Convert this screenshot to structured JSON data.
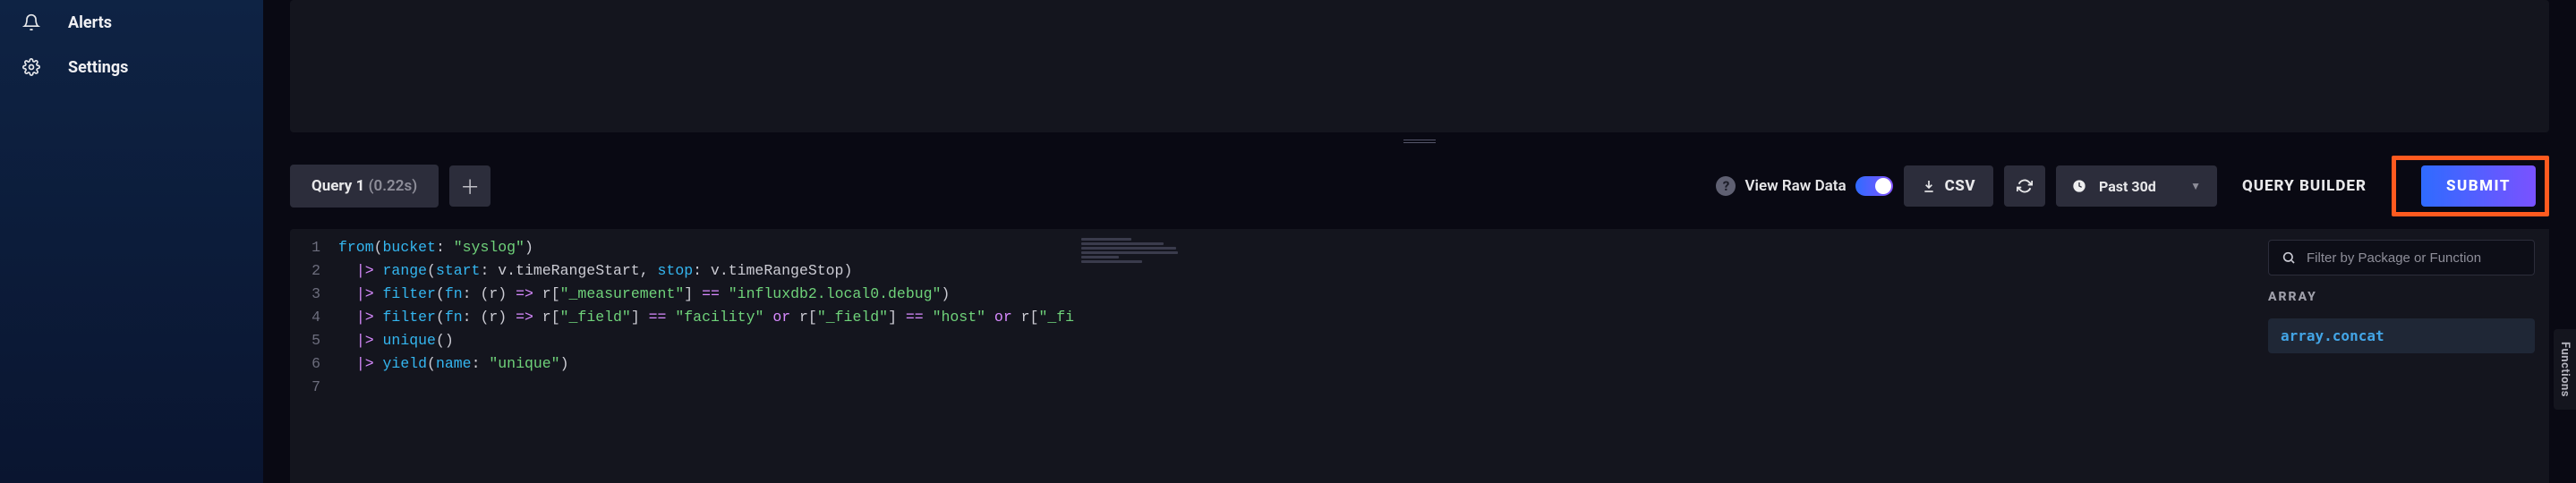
{
  "sidebar": {
    "items": [
      {
        "label": "Alerts",
        "icon": "bell-icon"
      },
      {
        "label": "Settings",
        "icon": "gear-icon"
      }
    ]
  },
  "toolbar": {
    "query_tab_label": "Query 1",
    "query_tab_duration": "(0.22s)",
    "view_raw_data_label": "View Raw Data",
    "raw_data_on": true,
    "csv_label": "CSV",
    "time_range_label": "Past 30d",
    "query_builder_label": "QUERY BUILDER",
    "submit_label": "SUBMIT"
  },
  "editor": {
    "flux_source": "from(bucket: \"syslog\")\n  |> range(start: v.timeRangeStart, stop: v.timeRangeStop)\n  |> filter(fn: (r) => r[\"_measurement\"] == \"influxdb2.local0.debug\")\n  |> filter(fn: (r) => r[\"_field\"] == \"facility\" or r[\"_field\"] == \"host\" or r[\"_fi\n  |> unique()\n  |> yield(name: \"unique\")\n",
    "lines": [
      {
        "n": 1,
        "tokens": [
          {
            "t": "from",
            "c": "tok-fn"
          },
          {
            "t": "(",
            "c": "tok-id"
          },
          {
            "t": "bucket",
            "c": "tok-key"
          },
          {
            "t": ": ",
            "c": "tok-colon"
          },
          {
            "t": "\"syslog\"",
            "c": "tok-str"
          },
          {
            "t": ")",
            "c": "tok-id"
          }
        ]
      },
      {
        "n": 2,
        "tokens": [
          {
            "t": "  ",
            "c": "tok-id"
          },
          {
            "t": "|>",
            "c": "tok-op"
          },
          {
            "t": " ",
            "c": "tok-id"
          },
          {
            "t": "range",
            "c": "tok-fn"
          },
          {
            "t": "(",
            "c": "tok-id"
          },
          {
            "t": "start",
            "c": "tok-key"
          },
          {
            "t": ": v.timeRangeStart, ",
            "c": "tok-var"
          },
          {
            "t": "stop",
            "c": "tok-key"
          },
          {
            "t": ": v.timeRangeStop)",
            "c": "tok-var"
          }
        ]
      },
      {
        "n": 3,
        "tokens": [
          {
            "t": "  ",
            "c": "tok-id"
          },
          {
            "t": "|>",
            "c": "tok-op"
          },
          {
            "t": " ",
            "c": "tok-id"
          },
          {
            "t": "filter",
            "c": "tok-fn"
          },
          {
            "t": "(",
            "c": "tok-id"
          },
          {
            "t": "fn",
            "c": "tok-key"
          },
          {
            "t": ": (r) ",
            "c": "tok-var"
          },
          {
            "t": "=>",
            "c": "tok-op"
          },
          {
            "t": " r[",
            "c": "tok-var"
          },
          {
            "t": "\"_measurement\"",
            "c": "tok-str"
          },
          {
            "t": "] ",
            "c": "tok-var"
          },
          {
            "t": "==",
            "c": "tok-op"
          },
          {
            "t": " ",
            "c": "tok-var"
          },
          {
            "t": "\"influxdb2.local0.debug\"",
            "c": "tok-str"
          },
          {
            "t": ")",
            "c": "tok-var"
          }
        ]
      },
      {
        "n": 4,
        "tokens": [
          {
            "t": "  ",
            "c": "tok-id"
          },
          {
            "t": "|>",
            "c": "tok-op"
          },
          {
            "t": " ",
            "c": "tok-id"
          },
          {
            "t": "filter",
            "c": "tok-fn"
          },
          {
            "t": "(",
            "c": "tok-id"
          },
          {
            "t": "fn",
            "c": "tok-key"
          },
          {
            "t": ": (r) ",
            "c": "tok-var"
          },
          {
            "t": "=>",
            "c": "tok-op"
          },
          {
            "t": " r[",
            "c": "tok-var"
          },
          {
            "t": "\"_field\"",
            "c": "tok-str"
          },
          {
            "t": "] ",
            "c": "tok-var"
          },
          {
            "t": "==",
            "c": "tok-op"
          },
          {
            "t": " ",
            "c": "tok-var"
          },
          {
            "t": "\"facility\"",
            "c": "tok-str"
          },
          {
            "t": " ",
            "c": "tok-var"
          },
          {
            "t": "or",
            "c": "tok-op"
          },
          {
            "t": " r[",
            "c": "tok-var"
          },
          {
            "t": "\"_field\"",
            "c": "tok-str"
          },
          {
            "t": "] ",
            "c": "tok-var"
          },
          {
            "t": "==",
            "c": "tok-op"
          },
          {
            "t": " ",
            "c": "tok-var"
          },
          {
            "t": "\"host\"",
            "c": "tok-str"
          },
          {
            "t": " ",
            "c": "tok-var"
          },
          {
            "t": "or",
            "c": "tok-op"
          },
          {
            "t": " r[",
            "c": "tok-var"
          },
          {
            "t": "\"_fi",
            "c": "tok-str"
          }
        ]
      },
      {
        "n": 5,
        "tokens": [
          {
            "t": "  ",
            "c": "tok-id"
          },
          {
            "t": "|>",
            "c": "tok-op"
          },
          {
            "t": " ",
            "c": "tok-id"
          },
          {
            "t": "unique",
            "c": "tok-fn"
          },
          {
            "t": "()",
            "c": "tok-id"
          }
        ]
      },
      {
        "n": 6,
        "tokens": [
          {
            "t": "  ",
            "c": "tok-id"
          },
          {
            "t": "|>",
            "c": "tok-op"
          },
          {
            "t": " ",
            "c": "tok-id"
          },
          {
            "t": "yield",
            "c": "tok-fn"
          },
          {
            "t": "(",
            "c": "tok-id"
          },
          {
            "t": "name",
            "c": "tok-key"
          },
          {
            "t": ": ",
            "c": "tok-colon"
          },
          {
            "t": "\"unique\"",
            "c": "tok-str"
          },
          {
            "t": ")",
            "c": "tok-id"
          }
        ]
      },
      {
        "n": 7,
        "tokens": []
      }
    ]
  },
  "functions_panel": {
    "filter_placeholder": "Filter by Package or Function",
    "group_title": "ARRAY",
    "items": [
      "array.concat"
    ],
    "side_tab_label": "Functions"
  },
  "minimap": {
    "line_widths": [
      56,
      92,
      106,
      108,
      42,
      68
    ]
  }
}
